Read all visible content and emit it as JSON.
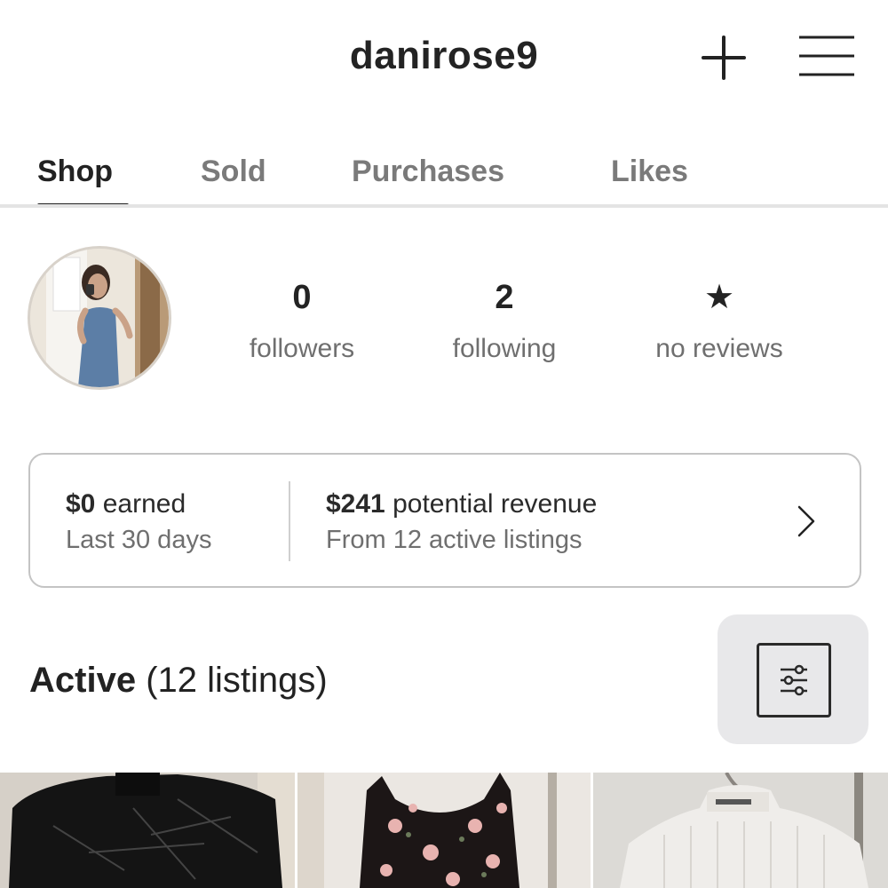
{
  "header": {
    "username": "danirose9",
    "add_icon": "plus-icon",
    "menu_icon": "hamburger-menu-icon"
  },
  "tabs": [
    {
      "label": "Shop",
      "active": true
    },
    {
      "label": "Sold",
      "active": false
    },
    {
      "label": "Purchases",
      "active": false
    },
    {
      "label": "Likes",
      "active": false
    }
  ],
  "profile": {
    "stats": [
      {
        "value": "0",
        "label": "followers"
      },
      {
        "value": "2",
        "label": "following"
      },
      {
        "value": "★",
        "label": "no reviews"
      }
    ]
  },
  "earnings": {
    "earned_amount": "$0",
    "earned_label": "earned",
    "earned_period": "Last 30 days",
    "revenue_amount": "$241",
    "revenue_label": "potential revenue",
    "revenue_source": "From 12 active listings"
  },
  "listings": {
    "title": "Active",
    "count_text": "(12 listings)",
    "filter_icon": "filter-sliders-icon"
  },
  "colors": {
    "text": "#222222",
    "muted": "#6f6f6f",
    "tab_inactive": "#7a7a7a",
    "divider": "#e4e4e4",
    "filter_bg": "#e8e8ea"
  }
}
